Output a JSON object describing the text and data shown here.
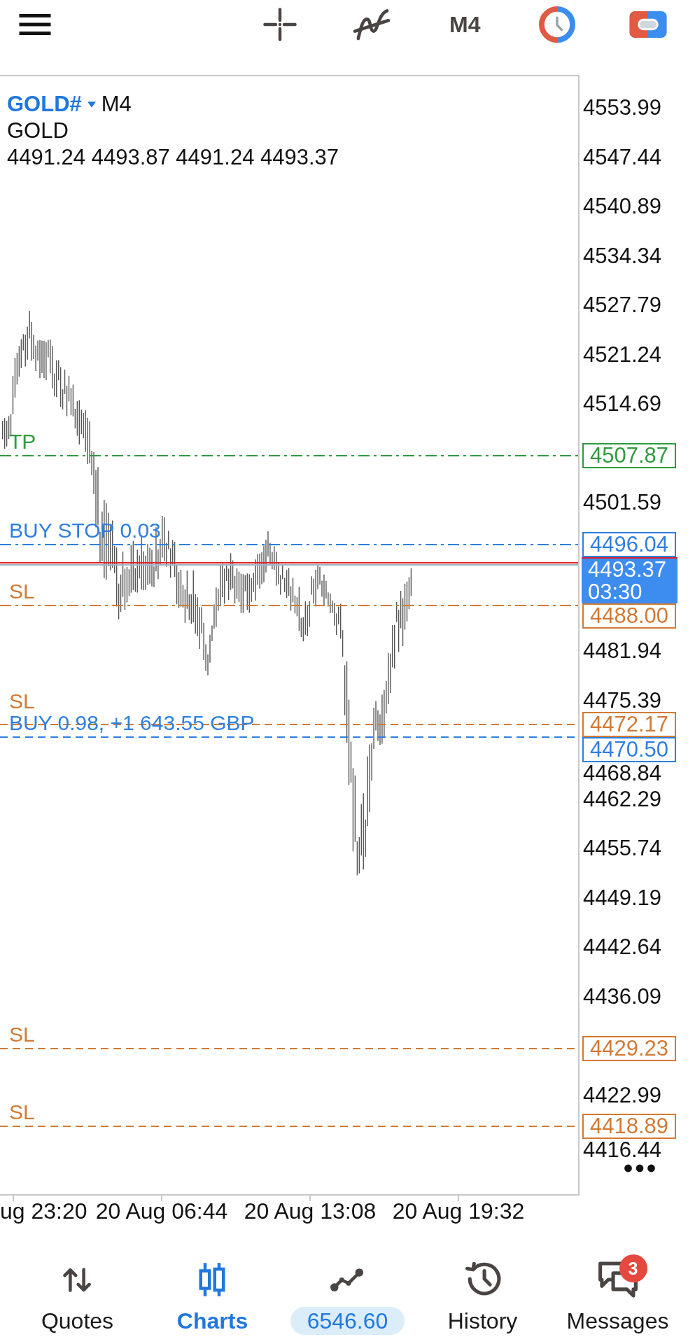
{
  "toolbar": {
    "timeframe": "M4"
  },
  "chart": {
    "symbol": "GOLD#",
    "timeframe": "M4",
    "description": "GOLD",
    "ohlc": "4491.24 4493.87 4491.24 4493.37",
    "price_ticks": [
      "4553.99",
      "4547.44",
      "4540.89",
      "4534.34",
      "4527.79",
      "4521.24",
      "4514.69",
      "4501.59",
      "4481.94",
      "4475.39",
      "4468.84",
      "4462.29",
      "4455.74",
      "4449.19",
      "4442.64",
      "4436.09",
      "4422.99",
      "4416.44"
    ],
    "order_lines": [
      {
        "label": "TP",
        "price": "4507.87",
        "color": "#2f9a3f",
        "dash_dot": true
      },
      {
        "label": "BUY STOP 0.03",
        "price": "4496.04",
        "color": "#2f7fe0",
        "dash_dot": true
      },
      {
        "label": "SL",
        "price": "4488.00",
        "color": "#d27a35",
        "dash_dot": true
      },
      {
        "label": "SL",
        "price": "4472.17",
        "color": "#d27a35",
        "dash_dot": false
      },
      {
        "label": "BUY 0.98, +1 643.55 GBP",
        "price": "4470.50",
        "color": "#2f7fe0",
        "dash_dot": false
      },
      {
        "label": "SL",
        "price": "4429.23",
        "color": "#d27a35",
        "dash_dot": false
      },
      {
        "label": "SL",
        "price": "4418.89",
        "color": "#d27a35",
        "dash_dot": false
      }
    ],
    "current_price": {
      "price": "4493.37",
      "countdown": "03:30"
    },
    "time_labels": [
      "ug 23:20",
      "20 Aug 06:44",
      "20 Aug 13:08",
      "20 Aug 19:32"
    ]
  },
  "nav": [
    {
      "label": "Quotes",
      "kind": "tab",
      "selected": false
    },
    {
      "label": "Charts",
      "kind": "tab",
      "selected": true
    },
    {
      "label": "6546.60",
      "kind": "pill",
      "selected": false
    },
    {
      "label": "History",
      "kind": "tab",
      "selected": false
    },
    {
      "label": "Messages",
      "kind": "tab",
      "selected": false,
      "badge": "3"
    }
  ]
}
